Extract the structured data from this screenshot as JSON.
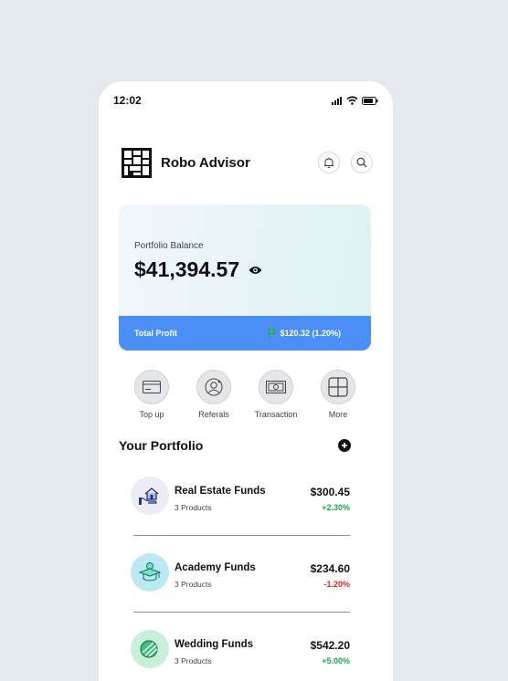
{
  "status_bar": {
    "time": "12:02"
  },
  "header": {
    "title": "Robo Advisor"
  },
  "balance": {
    "label": "Portfolio Balance",
    "value": "$41,394.57",
    "profit_label": "Total Profit",
    "profit_value": "$120.32 (1.20%)"
  },
  "actions": [
    {
      "label": "Top up",
      "icon": "card-icon"
    },
    {
      "label": "Referals",
      "icon": "user-circle-icon"
    },
    {
      "label": "Transaction",
      "icon": "cash-icon"
    },
    {
      "label": "More",
      "icon": "grid-icon"
    }
  ],
  "portfolio": {
    "title": "Your Portfolio",
    "funds": [
      {
        "name": "Real Estate Funds",
        "products": "3 Products",
        "amount": "$300.45",
        "change": "+2.30%",
        "icon": "house-hand-icon"
      },
      {
        "name": "Academy Funds",
        "products": "3 Products",
        "amount": "$234.60",
        "change": "-1.20%",
        "icon": "graduation-cap-icon"
      },
      {
        "name": "Wedding Funds",
        "products": "3 Products",
        "amount": "$542.20",
        "change": "+5.00%",
        "icon": "rings-icon"
      }
    ]
  },
  "colors": {
    "accent": "#4b8ef5",
    "positive": "#1aa84a",
    "negative": "#e02020"
  }
}
